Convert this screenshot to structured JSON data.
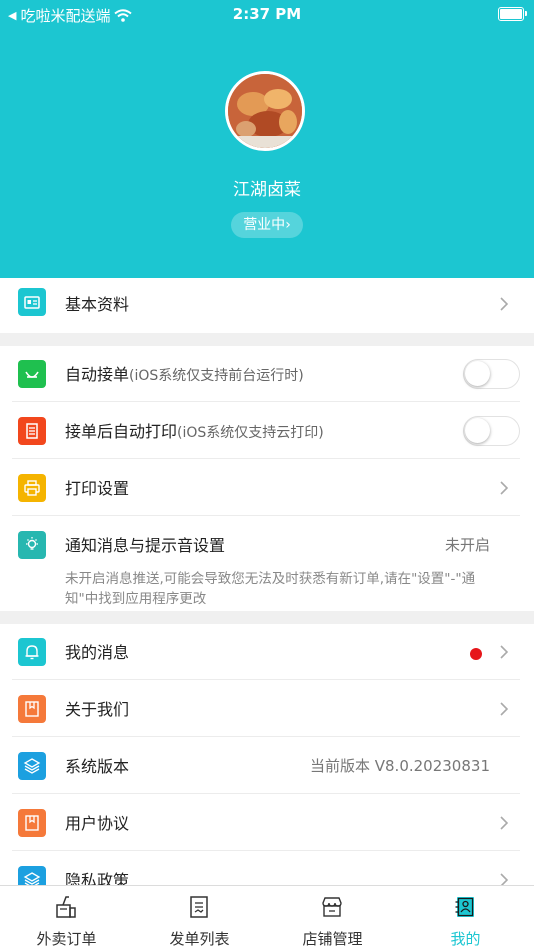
{
  "status_bar": {
    "back_app": "吃啦米配送端",
    "time": "2:37 PM"
  },
  "profile": {
    "shop_name": "江湖卤菜",
    "status_button": "营业中",
    "status_chevron": "›"
  },
  "menu": {
    "basic_info": {
      "label": "基本资料",
      "icon": "id-card-icon"
    },
    "auto_accept": {
      "label": "自动接单",
      "sublabel": "(iOS系统仅支持前台运行时)",
      "enabled": false,
      "icon": "auto-accept-icon"
    },
    "auto_print": {
      "label": "接单后自动打印",
      "sublabel": "(iOS系统仅支持云打印)",
      "enabled": false,
      "icon": "receipt-icon"
    },
    "print_settings": {
      "label": "打印设置",
      "icon": "printer-icon"
    },
    "notification": {
      "label": "通知消息与提示音设置",
      "value": "未开启",
      "note": "未开启消息推送,可能会导致您无法及时获悉有新订单,请在\"设置\"-\"通知\"中找到应用程序更改",
      "icon": "lightbulb-icon"
    },
    "my_messages": {
      "label": "我的消息",
      "has_unread": true,
      "icon": "bell-icon"
    },
    "about_us": {
      "label": "关于我们",
      "icon": "bookmark-icon"
    },
    "system_version": {
      "label": "系统版本",
      "value": "当前版本 V8.0.20230831",
      "icon": "layers-icon"
    },
    "user_agreement": {
      "label": "用户协议",
      "icon": "bookmark-icon"
    },
    "privacy_policy": {
      "label": "隐私政策",
      "icon": "layers-icon"
    }
  },
  "tabs": [
    {
      "label": "外卖订单",
      "icon": "takeout-icon",
      "active": false
    },
    {
      "label": "发单列表",
      "icon": "list-icon",
      "active": false
    },
    {
      "label": "店铺管理",
      "icon": "store-icon",
      "active": false
    },
    {
      "label": "我的",
      "icon": "contacts-icon",
      "active": true
    }
  ],
  "colors": {
    "brand": "#1cc6d1",
    "green": "#1fc04f",
    "red": "#f2471d",
    "yellow": "#f5b400",
    "teal": "#27b7b0",
    "orange": "#f5793a",
    "unread_dot": "#e6161a"
  }
}
